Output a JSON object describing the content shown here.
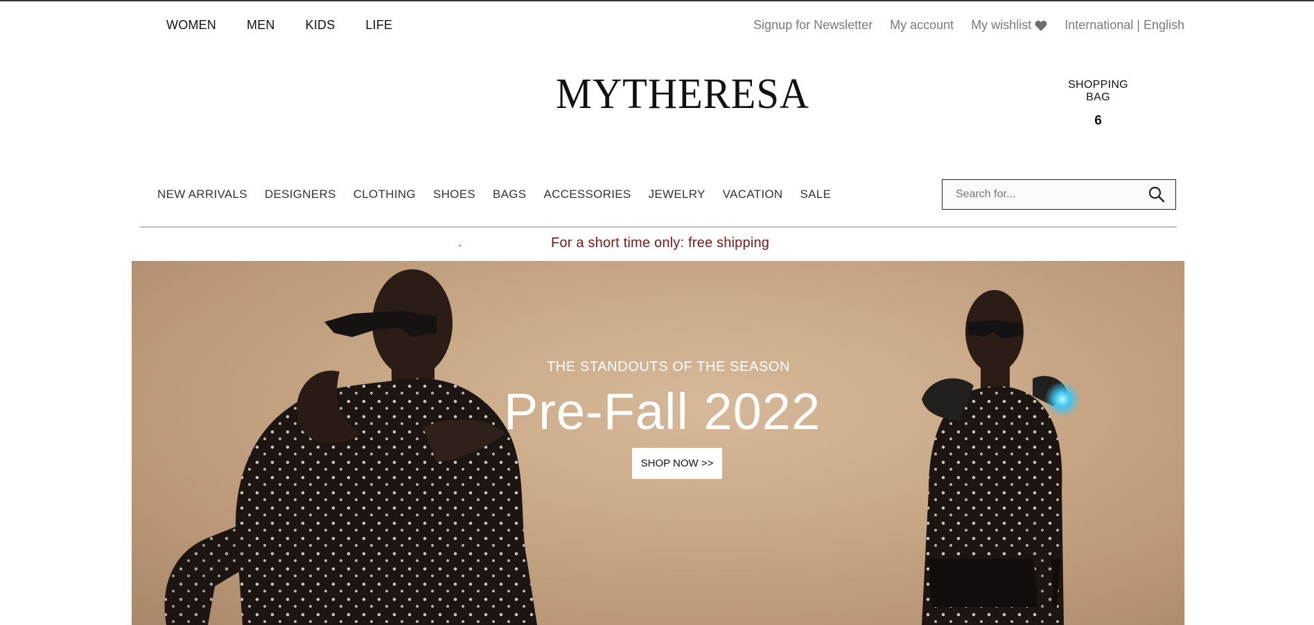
{
  "top_nav": {
    "items": [
      {
        "label": "WOMEN"
      },
      {
        "label": "MEN"
      },
      {
        "label": "KIDS"
      },
      {
        "label": "LIFE"
      }
    ]
  },
  "top_links": {
    "newsletter": "Signup for Newsletter",
    "account": "My account",
    "wishlist": "My wishlist",
    "locale": "International | English"
  },
  "brand": {
    "logo_text": "MYTHERESA"
  },
  "bag": {
    "label": "SHOPPING BAG",
    "count": "6"
  },
  "main_nav": {
    "items": [
      {
        "label": "NEW ARRIVALS"
      },
      {
        "label": "DESIGNERS"
      },
      {
        "label": "CLOTHING"
      },
      {
        "label": "SHOES"
      },
      {
        "label": "BAGS"
      },
      {
        "label": "ACCESSORIES"
      },
      {
        "label": "JEWELRY"
      },
      {
        "label": "VACATION"
      },
      {
        "label": "SALE"
      }
    ]
  },
  "search": {
    "placeholder": "Search for...",
    "value": ""
  },
  "promo": {
    "dot": ".",
    "text": "For a short time only: free shipping",
    "color": "#7d1616"
  },
  "hero": {
    "eyebrow": "THE STANDOUTS OF THE SEASON",
    "headline": "Pre-Fall 2022",
    "cta": "SHOP NOW >>",
    "bg_color": "#c8a887"
  },
  "icons": {
    "wishlist": "heart-icon",
    "search": "search-icon"
  }
}
